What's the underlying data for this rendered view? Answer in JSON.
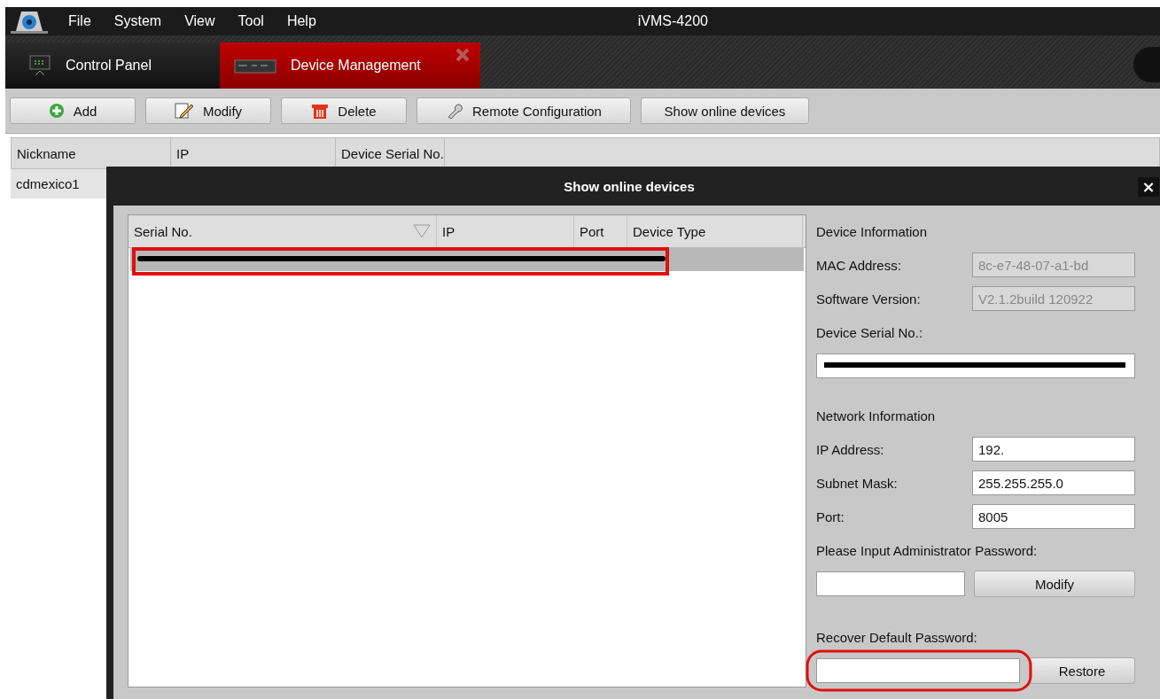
{
  "menu": {
    "items": [
      "File",
      "System",
      "View",
      "Tool",
      "Help"
    ],
    "title": "iVMS-4200"
  },
  "tabs": [
    {
      "label": "Control Panel",
      "kind": "panel",
      "selected": false
    },
    {
      "label": "Device Management",
      "kind": "device",
      "selected": true
    }
  ],
  "toolbar": [
    {
      "label": "Add",
      "kind": "add"
    },
    {
      "label": "Modify",
      "kind": "modify"
    },
    {
      "label": "Delete",
      "kind": "delete"
    },
    {
      "label": "Remote Configuration",
      "kind": "config"
    },
    {
      "label": "Show online devices",
      "kind": "plain"
    }
  ],
  "device_table": {
    "columns": [
      "Nickname",
      "IP",
      "Device Serial No."
    ],
    "rows": [
      {
        "nickname": "cdmexico1"
      }
    ]
  },
  "dialog": {
    "title": "Show online devices",
    "close": "×",
    "list": {
      "columns": [
        "Serial No.",
        "IP",
        "Port",
        "Device Type"
      ],
      "rows": [
        {
          "selected": true,
          "redacted": true,
          "highlighted": true
        }
      ]
    },
    "device_info": {
      "heading": "Device Information",
      "fields": [
        {
          "label": "MAC Address:",
          "value": "8c-e7-48-07-a1-bd",
          "disabled": true
        },
        {
          "label": "Software Version:",
          "value": "V2.1.2build 120922",
          "disabled": true
        }
      ],
      "serial_label": "Device Serial No.:",
      "serial_redacted": true
    },
    "network_info": {
      "heading": "Network Information",
      "fields": [
        {
          "label": "IP Address:",
          "value": "192.",
          "disabled": false
        },
        {
          "label": "Subnet Mask:",
          "value": "255.255.255.0",
          "disabled": false
        },
        {
          "label": "Port:",
          "value": "8005",
          "disabled": false
        }
      ]
    },
    "admin_password": {
      "label": "Please Input Administrator Password:",
      "button": "Modify"
    },
    "recover_password": {
      "label": "Recover Default Password:",
      "button": "Restore",
      "highlighted": true
    }
  }
}
